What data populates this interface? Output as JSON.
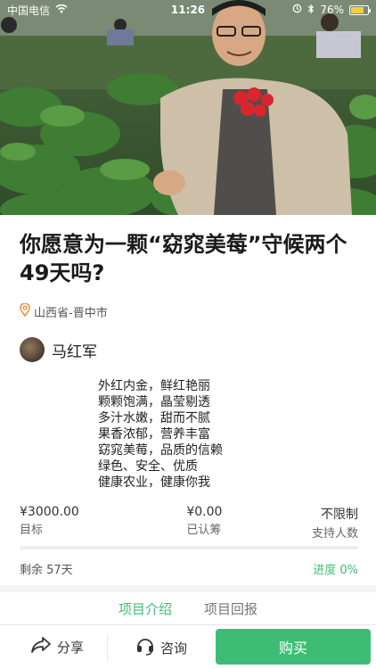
{
  "status_bar": {
    "carrier": "中国电信",
    "time": "11:26",
    "battery": "76%",
    "battery_level": 0.76
  },
  "project": {
    "title": "你愿意为一颗“窈窕美莓”守候两个49天吗?",
    "location": "山西省-晋中市",
    "author": "马红军",
    "description": [
      "外红内金，鲜红艳丽",
      "颗颗饱满，晶莹剔透",
      "多汁水嫩，甜而不腻",
      "果香浓郁，营养丰富",
      "窈窕美莓，品质的信赖",
      "绿色、安全、优质",
      "健康农业，健康你我"
    ]
  },
  "stats": {
    "target_value": "¥3000.00",
    "target_label": "目标",
    "raised_value": "¥0.00",
    "raised_label": "已认筹",
    "supporters_value": "不限制",
    "supporters_label": "支持人数"
  },
  "progress": {
    "remaining": "剩余 57天",
    "progress_text": "进度 0%",
    "fraction": 0.0
  },
  "tabs": [
    {
      "label": "项目介绍",
      "active": true
    },
    {
      "label": "项目回报",
      "active": false
    }
  ],
  "bottom_bar": {
    "share_label": "分享",
    "consult_label": "咨询",
    "buy_label": "购买"
  },
  "colors": {
    "accent": "#3dbd74",
    "location_icon": "#f08a3c"
  }
}
